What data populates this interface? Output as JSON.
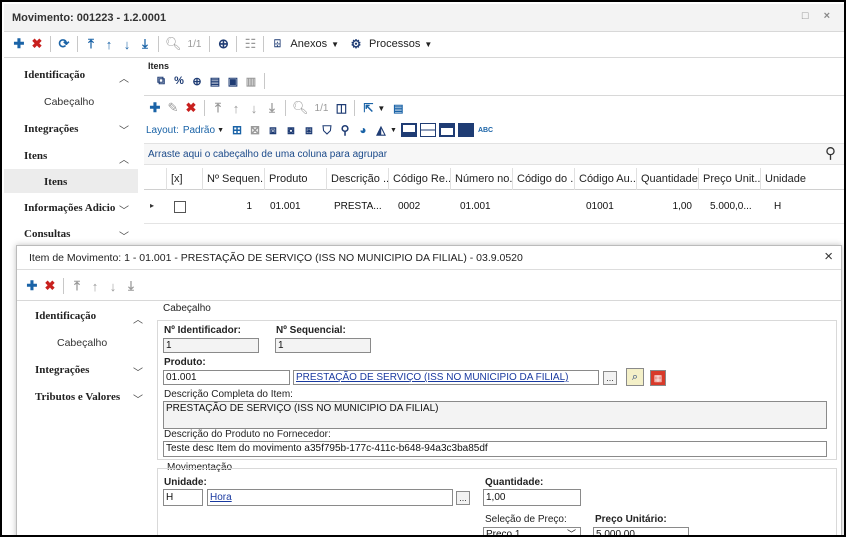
{
  "window": {
    "title": "Movimento: 001223 - 1.2.0001",
    "controls": "□ ×"
  },
  "toolbar": {
    "page_indicator": "1/1",
    "anexos": "Anexos",
    "processos": "Processos"
  },
  "sidebar": {
    "items": [
      {
        "label": "Identificação"
      },
      {
        "label": "Cabeçalho"
      },
      {
        "label": "Integrações"
      },
      {
        "label": "Itens"
      },
      {
        "label": "Itens"
      },
      {
        "label": "Informações Adicio"
      },
      {
        "label": "Consultas"
      }
    ]
  },
  "itens": {
    "section_label": "Itens",
    "page_indicator": "1/1",
    "layout_label": "Layout:",
    "layout_value": "Padrão",
    "group_hint": "Arraste aqui o cabeçalho de uma coluna para agrupar",
    "columns": [
      "[x]",
      "Nº Sequen...",
      "Produto",
      "Descrição ...",
      "Código Re...",
      "Número no...",
      "Código do ...",
      "Código Au...",
      "Quantidade",
      "Preço Unit...",
      "Unidade"
    ],
    "row": [
      "",
      "1",
      "01.001",
      "PRESTA...",
      "0002",
      "01.001",
      "",
      "01001",
      "1,00",
      "5.000,0...",
      "H"
    ]
  },
  "modal": {
    "title": "Item de Movimento: 1 - 01.001 - PRESTAÇÃO DE SERVIÇO (ISS NO MUNICIPIO DA FILIAL) - 03.9.0520",
    "sidebar": [
      {
        "label": "Identificação"
      },
      {
        "label": "Cabeçalho"
      },
      {
        "label": "Integrações"
      },
      {
        "label": "Tributos e Valores"
      }
    ],
    "cabecalho_group": "Cabeçalho",
    "n_identificador_label": "Nº Identificador:",
    "n_identificador_value": "1",
    "n_sequencial_label": "Nº Sequencial:",
    "n_sequencial_value": "1",
    "produto_label": "Produto:",
    "produto_code": "01.001",
    "produto_desc": "PRESTAÇÃO DE SERVIÇO (ISS NO MUNICIPIO DA FILIAL)",
    "desc_completa_label": "Descrição Completa do Item:",
    "desc_completa_value": "PRESTAÇÃO DE SERVIÇO (ISS NO MUNICIPIO DA FILIAL)",
    "desc_fornecedor_label": "Descrição do Produto no Fornecedor:",
    "desc_fornecedor_value": "Teste desc Item do movimento a35f795b-177c-411c-b648-94a3c3ba85df",
    "movimentacao_group": "Movimentação",
    "unidade_label": "Unidade:",
    "unidade_code": "H",
    "unidade_desc": "Hora",
    "quantidade_label": "Quantidade:",
    "quantidade_value": "1,00",
    "selecao_preco_label": "Seleção de Preço:",
    "selecao_preco_value": "Preço 1",
    "preco_unitario_label": "Preço Unitário:",
    "preco_unitario_value": "5.000,00",
    "ellipsis": "..."
  },
  "colors": {
    "accent_blue": "#1a63a7",
    "delete_red": "#c8201e",
    "add_blue": "#0a64a0",
    "link_blue": "#1a3aa0"
  }
}
